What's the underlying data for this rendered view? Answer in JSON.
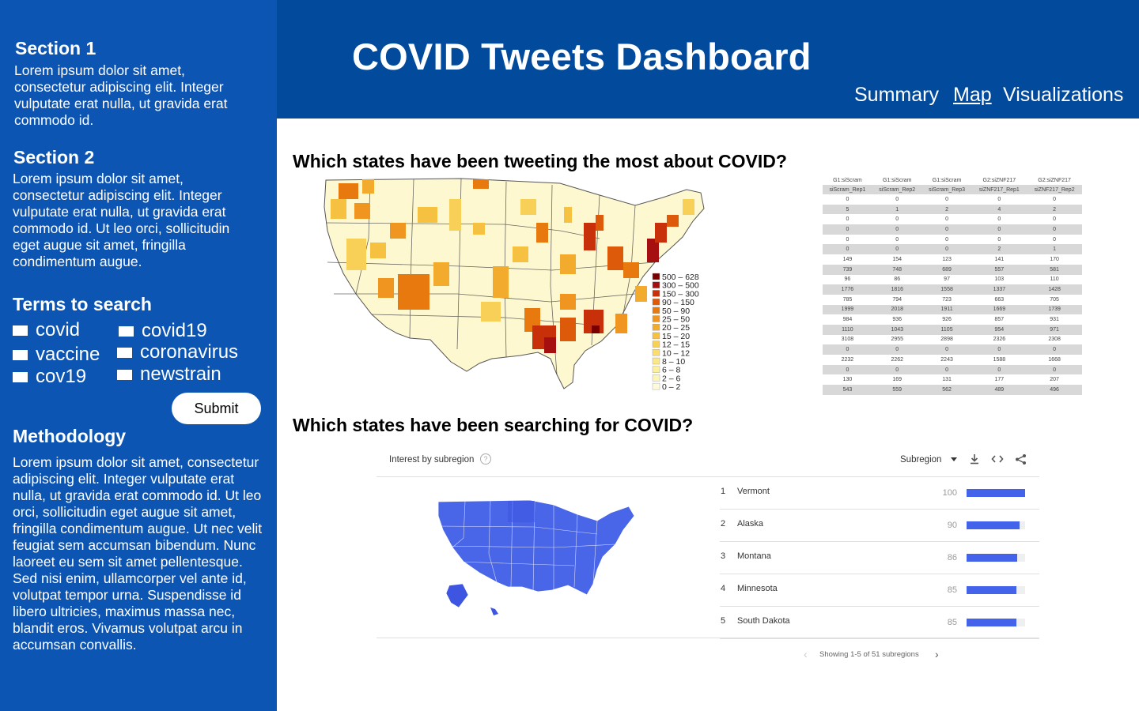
{
  "sidebar": {
    "section1": {
      "title": "Section 1",
      "text": "Lorem ipsum dolor sit amet, consectetur adipiscing elit. Integer vulputate erat nulla, ut gravida erat commodo id."
    },
    "section2": {
      "title": "Section 2",
      "text": "Lorem ipsum dolor sit amet, consectetur adipiscing elit. Integer vulputate erat nulla, ut gravida erat commodo id. Ut leo orci, sollicitudin eget augue sit amet, fringilla condimentum augue."
    },
    "terms": {
      "title": "Terms to search",
      "items": [
        "covid",
        "covid19",
        "vaccine",
        "coronavirus",
        "cov19",
        "newstrain"
      ]
    },
    "submit_label": "Submit",
    "methodology": {
      "title": "Methodology",
      "text": "Lorem ipsum dolor sit amet, consectetur adipiscing elit. Integer vulputate erat nulla, ut gravida erat commodo id. Ut leo orci, sollicitudin eget augue sit amet, fringilla condimentum augue. Ut nec velit feugiat sem accumsan bibendum. Nunc laoreet eu sem sit amet pellentesque. Sed nisi enim, ullamcorper vel ante id, volutpat tempor urna. Suspendisse id libero ultricies, maximus massa nec, blandit eros. Vivamus volutpat arcu in accumsan convallis."
    }
  },
  "header": {
    "title": "COVID Tweets Dashboard",
    "nav": [
      "Summary",
      "Map",
      "Visualizations"
    ],
    "active_nav": "Map"
  },
  "main": {
    "q1": "Which states have been tweeting the most about COVID?",
    "q2": "Which states have been searching for COVID?",
    "legend": [
      "500 – 628",
      "300 – 500",
      "150 – 300",
      "90 – 150",
      "50 – 90",
      "25 – 50",
      "20 – 25",
      "15 – 20",
      "12 – 15",
      "10 – 12",
      "8 – 10",
      "6 – 8",
      "2 – 6",
      "0 – 2"
    ],
    "legend_colors": [
      "#7a0000",
      "#a50f0f",
      "#c8300a",
      "#dc5a0a",
      "#e8790f",
      "#f09520",
      "#f3ab2e",
      "#f6c040",
      "#f8d057",
      "#fadd6e",
      "#fbe785",
      "#fcef9d",
      "#fdf5b8",
      "#fefbdc"
    ],
    "table": {
      "headers_top": [
        "G1:siScram",
        "G1:siScram",
        "G1:siScram",
        "G2:siZNF217",
        "G2:siZNF217"
      ],
      "headers_sub": [
        "siScram_Rep1",
        "siScram_Rep2",
        "siScram_Rep3",
        "siZNF217_Rep1",
        "siZNF217_Rep2"
      ],
      "rows": [
        [
          "0",
          "0",
          "0",
          "0",
          "0"
        ],
        [
          "5",
          "1",
          "2",
          "4",
          "2"
        ],
        [
          "0",
          "0",
          "0",
          "0",
          "0"
        ],
        [
          "0",
          "0",
          "0",
          "0",
          "0"
        ],
        [
          "0",
          "0",
          "0",
          "0",
          "0"
        ],
        [
          "0",
          "0",
          "0",
          "2",
          "1"
        ],
        [
          "149",
          "154",
          "123",
          "141",
          "170"
        ],
        [
          "739",
          "748",
          "689",
          "557",
          "581"
        ],
        [
          "96",
          "86",
          "97",
          "103",
          "110"
        ],
        [
          "1776",
          "1816",
          "1558",
          "1337",
          "1428"
        ],
        [
          "785",
          "794",
          "723",
          "663",
          "705"
        ],
        [
          "1999",
          "2018",
          "1911",
          "1669",
          "1739"
        ],
        [
          "984",
          "936",
          "926",
          "857",
          "931"
        ],
        [
          "1110",
          "1043",
          "1105",
          "954",
          "971"
        ],
        [
          "3108",
          "2955",
          "2898",
          "2326",
          "2308"
        ],
        [
          "0",
          "0",
          "0",
          "0",
          "0"
        ],
        [
          "2232",
          "2262",
          "2243",
          "1588",
          "1668"
        ],
        [
          "0",
          "0",
          "0",
          "0",
          "0"
        ],
        [
          "130",
          "169",
          "131",
          "177",
          "207"
        ],
        [
          "543",
          "559",
          "562",
          "489",
          "496"
        ]
      ]
    },
    "trends": {
      "title": "Interest by subregion",
      "help": "?",
      "dropdown": "Subregion",
      "rows": [
        {
          "rank": "1",
          "name": "Vermont",
          "value": 100
        },
        {
          "rank": "2",
          "name": "Alaska",
          "value": 90
        },
        {
          "rank": "3",
          "name": "Montana",
          "value": 86
        },
        {
          "rank": "4",
          "name": "Minnesota",
          "value": 85
        },
        {
          "rank": "5",
          "name": "South Dakota",
          "value": 85
        }
      ],
      "pager": "Showing 1-5 of 51 subregions"
    }
  },
  "colors": {
    "sidebar_bg": "#0d55b3",
    "header_bg": "#024a9c",
    "bar": "#4364ea",
    "map_blue": "#4a66e8"
  }
}
